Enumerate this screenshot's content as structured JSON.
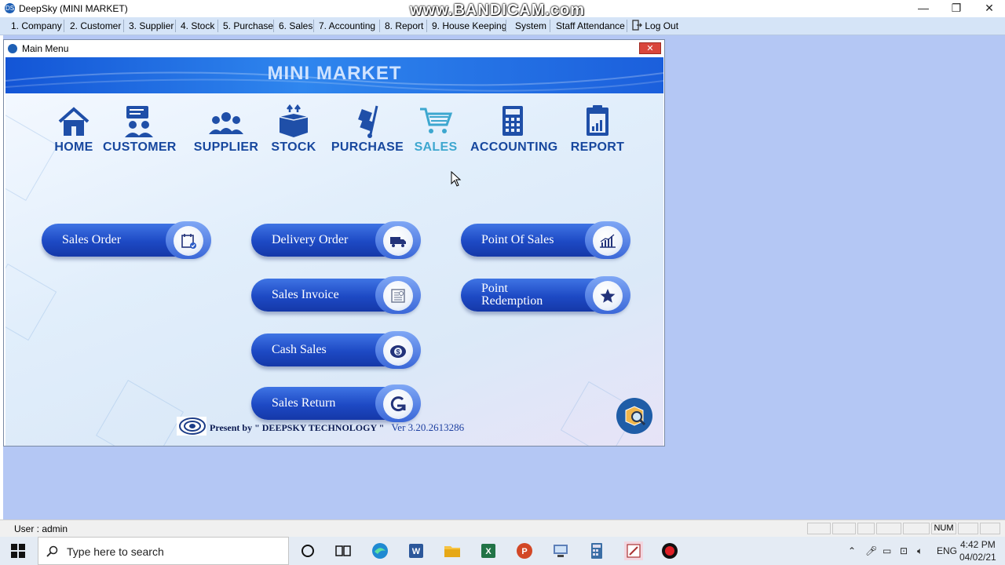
{
  "app": {
    "title": "DeepSky (MINI MARKET)",
    "watermark": "www.BANDICAM.com",
    "window_controls": [
      "—",
      "❐",
      "✕"
    ]
  },
  "menu": [
    {
      "label": "1. Company"
    },
    {
      "label": "2. Customer"
    },
    {
      "label": "3. Supplier"
    },
    {
      "label": "4. Stock"
    },
    {
      "label": "5. Purchase"
    },
    {
      "label": "6. Sales"
    },
    {
      "label": "7. Accounting"
    },
    {
      "label": "8. Report"
    },
    {
      "label": "9. House Keeping"
    },
    {
      "label": "System"
    },
    {
      "label": "Staff Attendance"
    },
    {
      "label": "Log Out"
    }
  ],
  "main_menu": {
    "window_title": "Main Menu",
    "close_label": "✕",
    "banner_title": "MINI MARKET",
    "nav": [
      {
        "label": "HOME",
        "icon": "house-icon",
        "active": false
      },
      {
        "label": "CUSTOMER",
        "icon": "customer-icon",
        "active": false
      },
      {
        "label": "SUPPLIER",
        "icon": "supplier-icon",
        "active": false
      },
      {
        "label": "STOCK",
        "icon": "stock-box-icon",
        "active": false
      },
      {
        "label": "PURCHASE",
        "icon": "hand-truck-icon",
        "active": false
      },
      {
        "label": "SALES",
        "icon": "cart-icon",
        "active": true
      },
      {
        "label": "ACCOUNTING",
        "icon": "calculator-icon",
        "active": false
      },
      {
        "label": "REPORT",
        "icon": "report-clipboard-icon",
        "active": false
      }
    ],
    "buttons": {
      "sales_order": "Sales Order",
      "delivery_order": "Delivery Order",
      "sales_invoice": "Sales Invoice",
      "cash_sales": "Cash Sales",
      "sales_return": "Sales Return",
      "point_of_sales": "Point Of Sales",
      "point_redemption_line1": "Point",
      "point_redemption_line2": "Redemption"
    },
    "footer_text": "Present by \" DEEPSKY TECHNOLOGY \"",
    "version": "Ver 3.20.2613286"
  },
  "status": {
    "user": "User :  admin",
    "num": "NUM"
  },
  "taskbar": {
    "search_placeholder": "Type here to search",
    "language": "ENG",
    "time": "4:42 PM",
    "date": "04/02/21"
  },
  "colors": {
    "mdi_background": "#b4c7f4",
    "menubar": "#d5e4f7",
    "nav_text": "#17479e",
    "nav_active": "#3da7cf",
    "pill_blue": "#1d49c4"
  }
}
